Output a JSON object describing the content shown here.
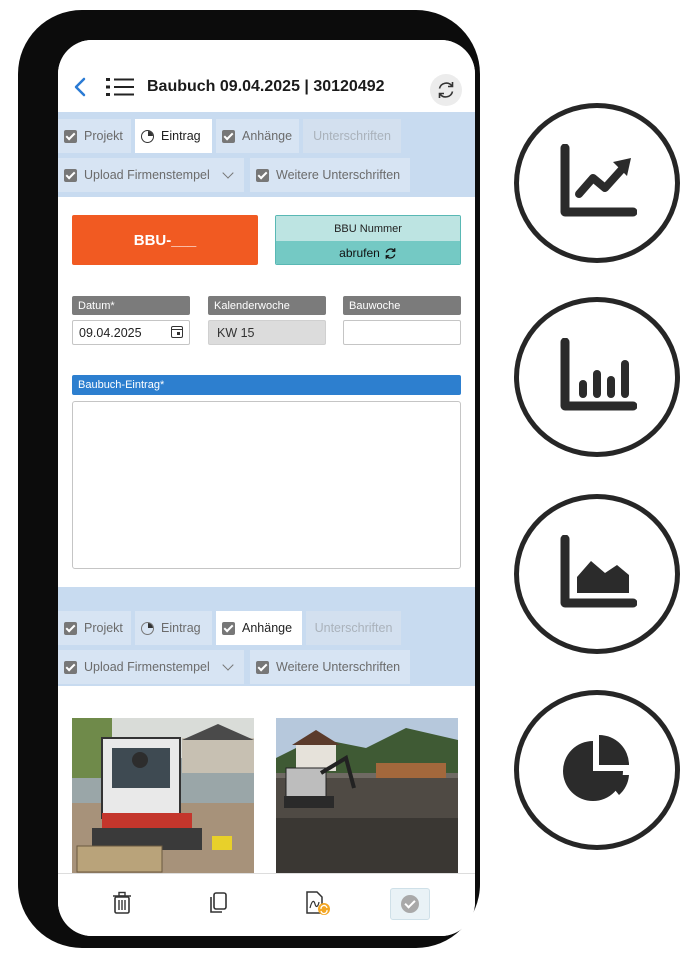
{
  "header": {
    "title": "Baubuch 09.04.2025 | 30120492",
    "back_icon": "chevron-left-icon",
    "menu_icon": "list-icon",
    "sync_icon": "sync-icon"
  },
  "tabs_top": [
    {
      "label": "Projekt",
      "state": "checked"
    },
    {
      "label": "Eintrag",
      "state": "active"
    },
    {
      "label": "Anhänge",
      "state": "checked"
    },
    {
      "label": "Unterschriften",
      "state": "disabled"
    },
    {
      "label": "Upload Firmenstempel",
      "state": "checked"
    },
    {
      "label": "Weitere Unterschriften",
      "state": "checked"
    }
  ],
  "tabs_bottom": [
    {
      "label": "Projekt",
      "state": "checked"
    },
    {
      "label": "Eintrag",
      "state": "normal"
    },
    {
      "label": "Anhänge",
      "state": "active"
    },
    {
      "label": "Unterschriften",
      "state": "disabled"
    },
    {
      "label": "Upload Firmenstempel",
      "state": "checked"
    },
    {
      "label": "Weitere Unterschriften",
      "state": "checked"
    }
  ],
  "form": {
    "bbu_button": "BBU-___",
    "bbu_nummer_label": "BBU Nummer",
    "abrufen_label": "abrufen",
    "datum_label": "Datum*",
    "datum_value": "09.04.2025",
    "kalenderwoche_label": "Kalenderwoche",
    "kalenderwoche_value": "KW 15",
    "bauwoche_label": "Bauwoche",
    "bauwoche_value": "",
    "eintrag_label": "Baubuch-Eintrag*",
    "eintrag_value": ""
  },
  "toolbar": {
    "icons": [
      "trash-icon",
      "copy-icon",
      "pdf-sync-icon",
      "check-circle-icon"
    ]
  },
  "side_icons": [
    "line-chart-icon",
    "bar-chart-icon",
    "area-chart-icon",
    "pie-chart-icon"
  ],
  "colors": {
    "accent_orange": "#f15a22",
    "teal": "#74c9c4",
    "blue_label": "#2d7fcf",
    "tab_band": "#c8dbf0"
  }
}
